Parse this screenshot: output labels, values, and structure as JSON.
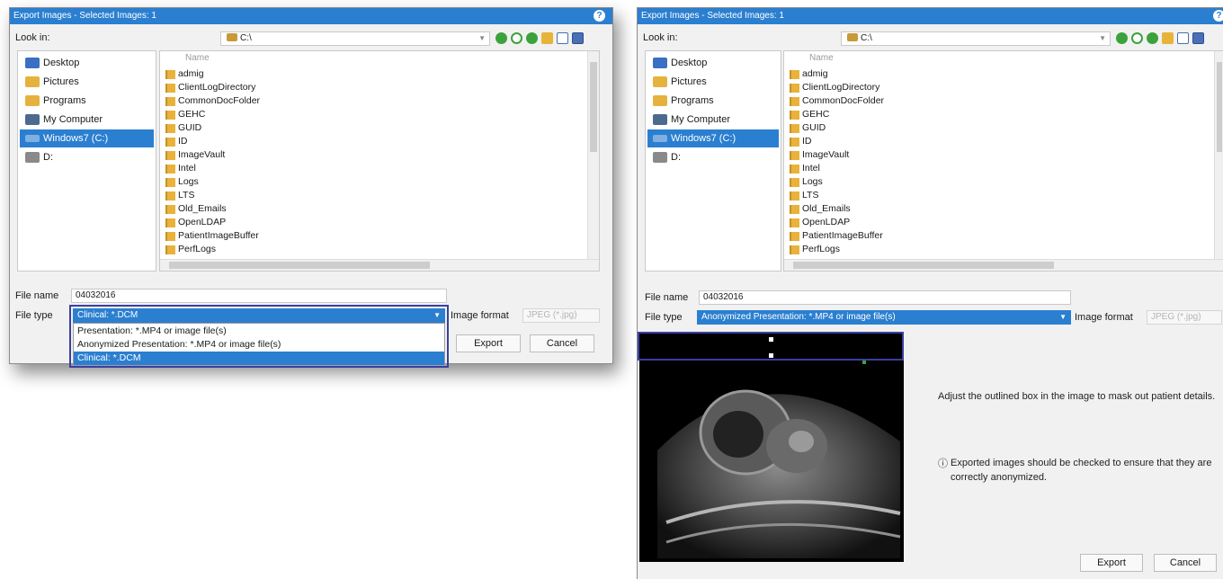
{
  "left_dialog": {
    "title": "Export Images - Selected Images: 1",
    "look_in_label": "Look in:",
    "look_in_value": "C:\\",
    "places": [
      "Desktop",
      "Pictures",
      "Programs",
      "My Computer",
      "Windows7 (C:)",
      "D:"
    ],
    "selected_place": "Windows7 (C:)",
    "column_name": "Name",
    "files": [
      "admig",
      "ClientLogDirectory",
      "CommonDocFolder",
      "GEHC",
      "GUID",
      "ID",
      "ImageVault",
      "Intel",
      "Logs",
      "LTS",
      "Old_Emails",
      "OpenLDAP",
      "PatientImageBuffer",
      "PerfLogs"
    ],
    "file_name_label": "File name",
    "file_name_value": "04032016",
    "file_type_label": "File type",
    "file_type_value": "Clinical: *.DCM",
    "file_type_options": [
      "Presentation: *.MP4 or image file(s)",
      "Anonymized Presentation: *.MP4 or image file(s)",
      "Clinical: *.DCM"
    ],
    "image_format_label": "Image format",
    "image_format_value": "JPEG (*.jpg)",
    "export_label": "Export",
    "cancel_label": "Cancel"
  },
  "right_dialog": {
    "title": "Export Images - Selected Images: 1",
    "look_in_label": "Look in:",
    "look_in_value": "C:\\",
    "places": [
      "Desktop",
      "Pictures",
      "Programs",
      "My Computer",
      "Windows7 (C:)",
      "D:"
    ],
    "selected_place": "Windows7 (C:)",
    "column_name": "Name",
    "files": [
      "admig",
      "ClientLogDirectory",
      "CommonDocFolder",
      "GEHC",
      "GUID",
      "ID",
      "ImageVault",
      "Intel",
      "Logs",
      "LTS",
      "Old_Emails",
      "OpenLDAP",
      "PatientImageBuffer",
      "PerfLogs"
    ],
    "file_name_label": "File name",
    "file_name_value": "04032016",
    "file_type_label": "File type",
    "file_type_value": "Anonymized Presentation: *.MP4 or image file(s)",
    "image_format_label": "Image format",
    "image_format_value": "JPEG (*.jpg)",
    "instruction": "Adjust the outlined box in the image to mask out patient details.",
    "warning": "Exported images should be checked to ensure that they are correctly anonymized.",
    "warning_icon": "info-circle-icon",
    "export_label": "Export",
    "cancel_label": "Cancel"
  },
  "colors": {
    "accent": "#2b7fd0",
    "highlight_outline": "#3b3fa0"
  }
}
